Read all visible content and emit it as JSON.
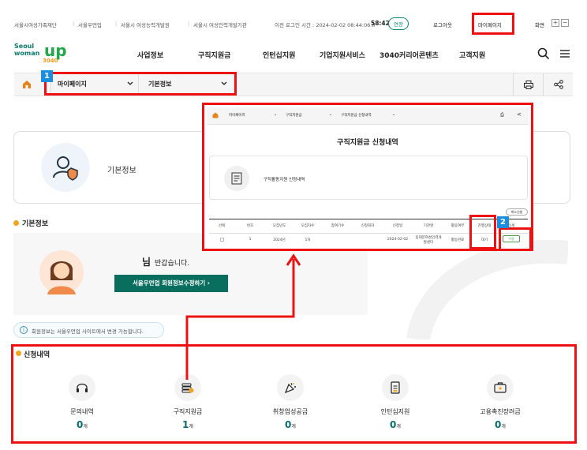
{
  "util_bar": {
    "links": [
      "서울시여성가족재단",
      "서울우먼업",
      "서울시 여성능력개발원",
      "서울시 여성인력개발기관"
    ],
    "login_time_label": "이전 로그인 시간 : 2024-02-02 08:44:06.0",
    "timer": "58:42",
    "extend_label": "연장",
    "logout_label": "로그아웃",
    "mypage_label": "마이페이지",
    "screen_label": "화면",
    "zoom_in": "+",
    "zoom_out": "−"
  },
  "brand": {
    "line1": "Seoul",
    "line2": "woman",
    "line3": "up",
    "line4": "3040"
  },
  "nav": {
    "menus": [
      "사업정보",
      "구직지원금",
      "인턴십지원",
      "기업지원서비스",
      "3040커리어콘텐츠",
      "고객지원"
    ]
  },
  "breadcrumb": {
    "level1": "마이페이지",
    "level2": "기본정보"
  },
  "annotations": {
    "badge1": "1",
    "badge2": "2"
  },
  "basic_info_card": {
    "title": "기본정보"
  },
  "section_basic": {
    "title": "기본정보"
  },
  "profile": {
    "greeting_suffix": "님",
    "greeting": "반갑습니다.",
    "edit_button": "서울우먼업 회원정보수정하기 ›"
  },
  "notice": {
    "text": "회원정보는 서울우먼업 사이트에서 변경 가능합니다."
  },
  "section_apply": {
    "title": "신청내역"
  },
  "stats": [
    {
      "label": "문의내역",
      "value": "0",
      "unit": "개",
      "icon": "headset-icon"
    },
    {
      "label": "구직지원금",
      "value": "1",
      "unit": "개",
      "icon": "money-stack-icon"
    },
    {
      "label": "취창업성공금",
      "value": "0",
      "unit": "개",
      "icon": "celebration-icon"
    },
    {
      "label": "인턴십지원",
      "value": "0",
      "unit": "개",
      "icon": "document-icon"
    },
    {
      "label": "고용촉진장려금",
      "value": "0",
      "unit": "개",
      "icon": "briefcase-icon"
    }
  ],
  "inset": {
    "breadcrumb": [
      "마이페이지",
      "구직지원금",
      "구직지원금 신청내역"
    ],
    "title": "구직지원금 신청내역",
    "item_label": "구직활동지원 신청내역",
    "cancel_button": "취소신청",
    "columns": [
      "선택",
      "번호",
      "모집년도",
      "모집차수",
      "참여기수",
      "신청회차",
      "신청일",
      "기관명",
      "활동여부",
      "진행상태",
      "상세"
    ],
    "row": [
      "",
      "1",
      "2024년",
      "1차",
      "",
      "",
      "2024-02-02",
      "동대문여성인력개발센터",
      "활동완료",
      "대기",
      "수정"
    ]
  }
}
